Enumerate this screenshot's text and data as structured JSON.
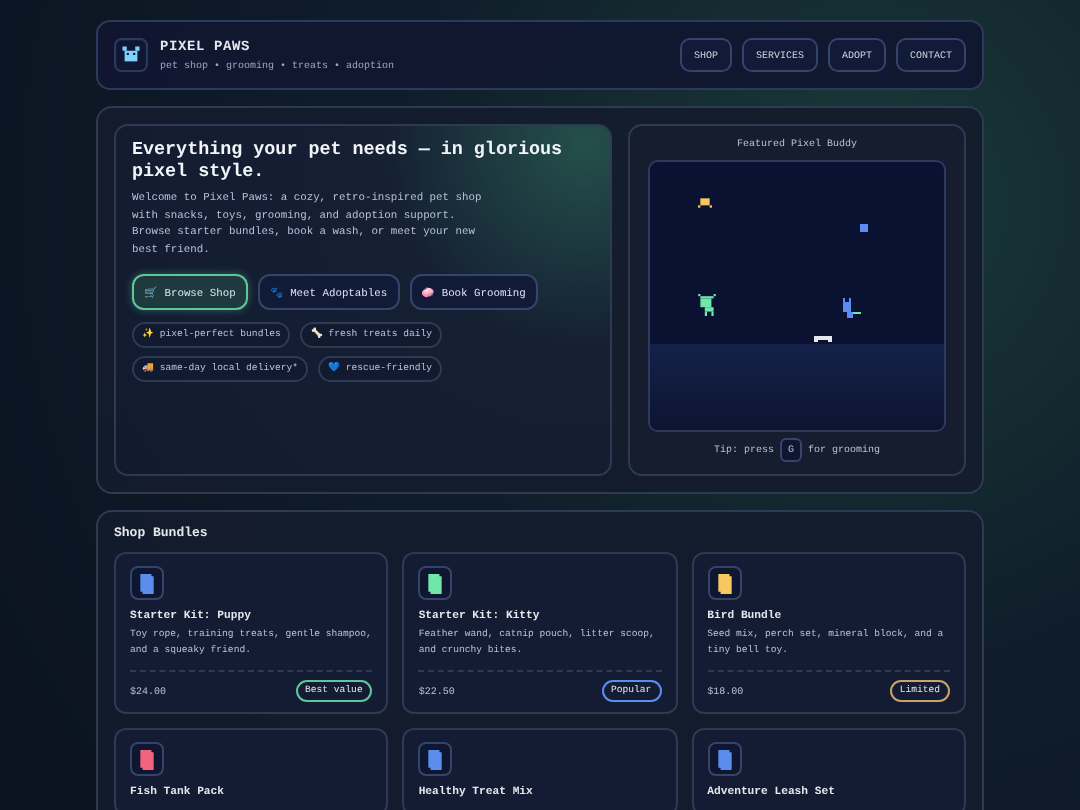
{
  "header": {
    "brand": "PIXEL PAWS",
    "tagline": "pet shop • grooming • treats • adoption",
    "nav": [
      "SHOP",
      "SERVICES",
      "ADOPT",
      "CONTACT"
    ]
  },
  "hero": {
    "title": "Everything your pet needs — in glorious pixel style.",
    "intro": "Welcome to Pixel Paws: a cozy, retro-inspired pet shop with snacks, toys, grooming, and adoption support. Browse starter bundles, book a wash, or meet your new best friend.",
    "buttons": [
      {
        "icon": "🛒",
        "label": "Browse Shop",
        "kind": "primary"
      },
      {
        "icon": "🐾",
        "label": "Meet Adoptables",
        "kind": "secondary"
      },
      {
        "icon": "🧼",
        "label": "Book Grooming",
        "kind": "secondary"
      }
    ],
    "chips": [
      {
        "icon": "✨",
        "label": "pixel-perfect bundles"
      },
      {
        "icon": "🦴",
        "label": "fresh treats daily"
      },
      {
        "icon": "🚚",
        "label": "same-day local delivery*"
      },
      {
        "icon": "💙",
        "label": "rescue-friendly"
      }
    ]
  },
  "featured": {
    "title": "Featured Pixel Buddy",
    "tip_before": "Tip: press",
    "key": "G",
    "tip_after": "for grooming"
  },
  "shop": {
    "title": "Shop Bundles",
    "bundles": [
      {
        "name": "Starter Kit: Puppy",
        "color": "#5b8def",
        "description": "Toy rope, training treats, gentle shampoo, and a squeaky friend.",
        "price": "$24.00",
        "badge": "Best value",
        "kind": "green"
      },
      {
        "name": "Starter Kit: Kitty",
        "color": "#6ee7a8",
        "description": "Feather wand, catnip pouch, litter scoop, and crunchy bites.",
        "price": "$22.50",
        "badge": "Popular",
        "kind": "blue"
      },
      {
        "name": "Bird Bundle",
        "color": "#f6c85f",
        "description": "Seed mix, perch set, mineral block, and a tiny bell toy.",
        "price": "$18.00",
        "badge": "Limited",
        "kind": "amber"
      },
      {
        "name": "Fish Tank Pack",
        "color": "#f2637e"
      },
      {
        "name": "Healthy Treat Mix",
        "color": "#5b8def"
      },
      {
        "name": "Adventure Leash Set",
        "color": "#5b8def"
      }
    ]
  }
}
